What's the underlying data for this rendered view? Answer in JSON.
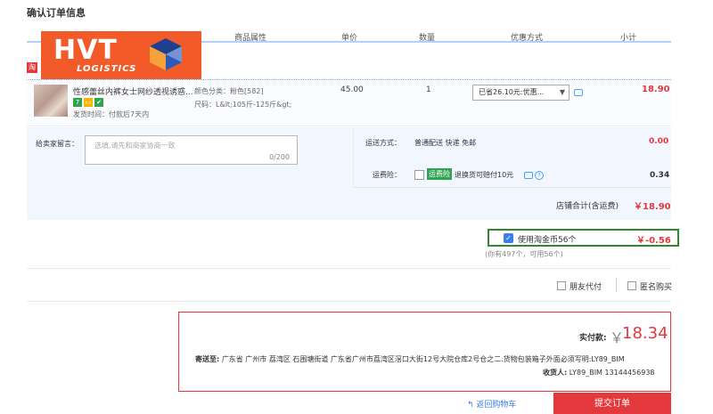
{
  "page": {
    "title": "确认订单信息"
  },
  "header": {
    "columns": [
      "商品属性",
      "单价",
      "数量",
      "优惠方式",
      "小计"
    ]
  },
  "logo": {
    "text": "HVT",
    "subtext": "LOGISTICS"
  },
  "shop": {
    "badge": "淘"
  },
  "item": {
    "name": "性感蕾丝内裤女士网纱透视诱惑...",
    "ship_time": "发货时间：付款后7天内",
    "attr_color": "颜色分类：粉色[582]",
    "attr_size": "尺码：L&lt;105斤-125斤&gt;",
    "price": "45.00",
    "quantity": "1",
    "promo": "已省26.10元:优惠...",
    "subtotal": "18.90"
  },
  "message": {
    "label": "给卖家留言：",
    "placeholder": "选填,请先和商家协商一致",
    "count": "0/200"
  },
  "shipping": {
    "label": "运送方式：",
    "value": "普通配送 快递 免邮",
    "cost": "0.00",
    "insurance_label": "运费险：",
    "insurance_badge": "运费险",
    "insurance_text": "退换货可赔付10元",
    "insurance_cost": "0.34"
  },
  "shop_total": {
    "label": "店铺合计(含运费)",
    "value": "￥18.90"
  },
  "coins": {
    "label": "使用淘金币56个",
    "value": "￥-0.56",
    "note": "(你有497个，可用56个)",
    "highlight_color": "#2f8a2f"
  },
  "options": {
    "friend_pay": "朋友代付",
    "anonymous": "匿名购买"
  },
  "summary": {
    "pay_label": "实付款:",
    "yen": "￥",
    "pay_value": "18.34",
    "address_label": "寄送至:",
    "address": "广东省 广州市 荔湾区 石围塘街道 广东省广州市荔湾区滘口大街12号大院仓库2号仓之二.货物包装箱子外面必须写明:LY89_BIM",
    "receiver_label": "收货人:",
    "receiver": "LY89_BIM 13144456938"
  },
  "footer": {
    "back_label": "返回购物车",
    "submit_label": "提交订单"
  },
  "colors": {
    "accent": "#e4393c",
    "link": "#3b7de9",
    "logo": "#f25a29"
  }
}
